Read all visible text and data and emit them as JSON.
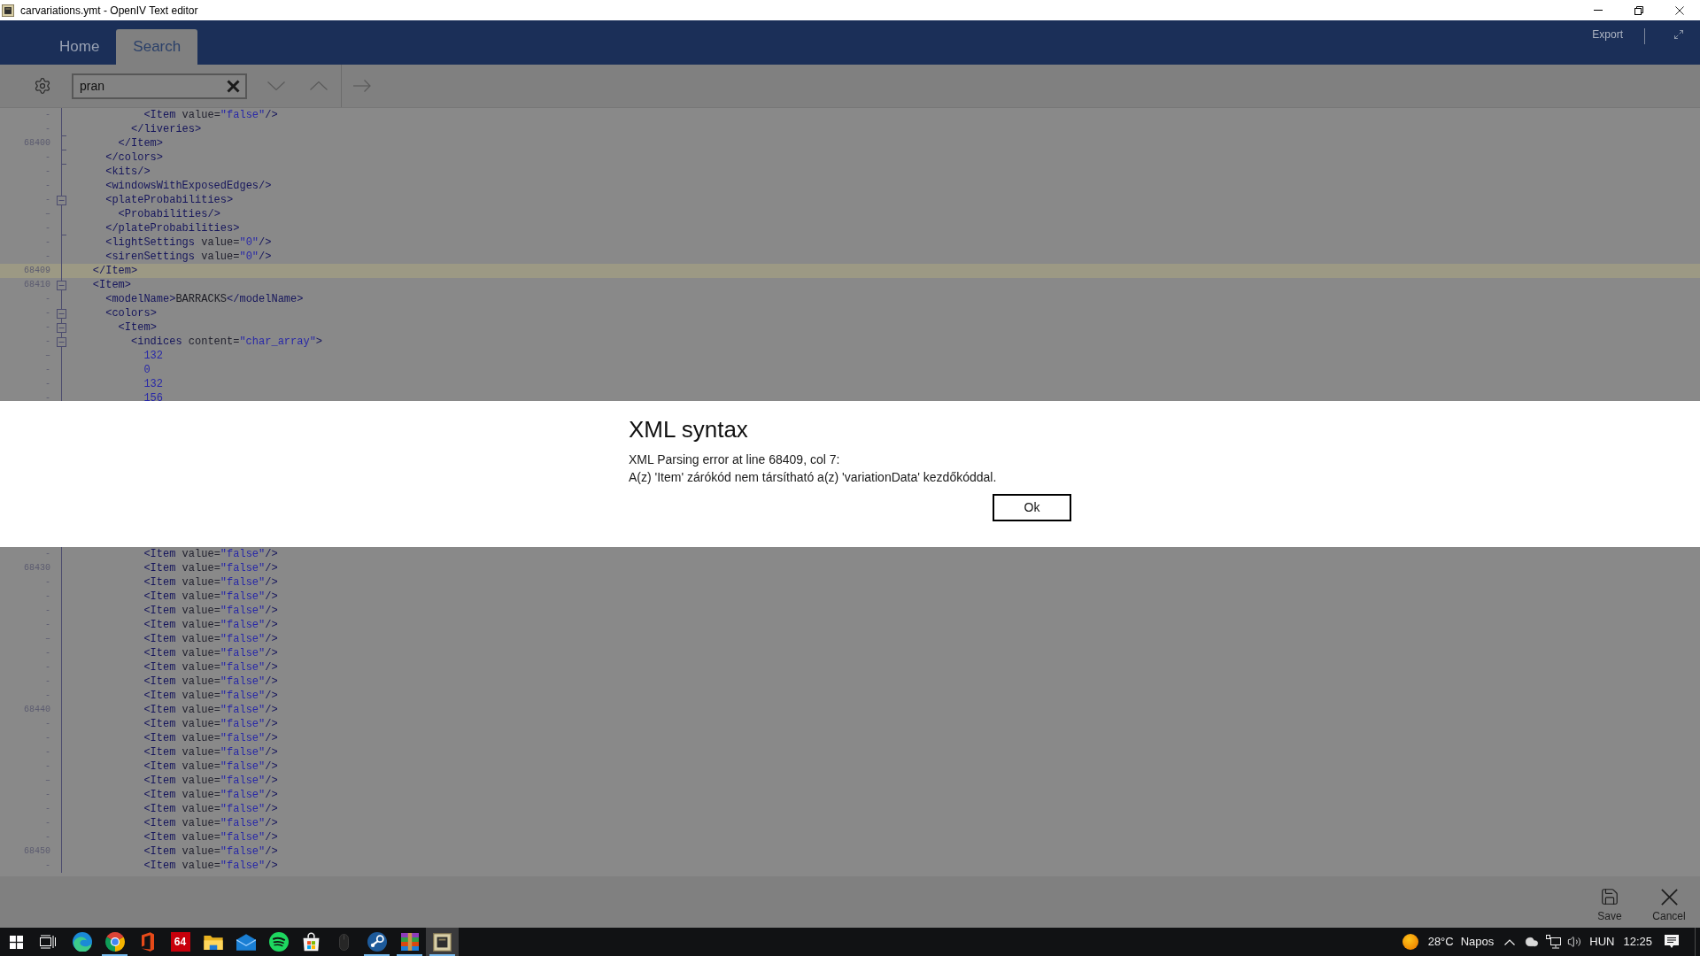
{
  "window": {
    "title": "carvariations.ymt - OpenIV Text editor"
  },
  "ribbon": {
    "tabs": [
      {
        "label": "Home",
        "selected": false
      },
      {
        "label": "Search",
        "selected": true
      }
    ],
    "action": "Export"
  },
  "search": {
    "value": "pran"
  },
  "editor": {
    "upper_lines": [
      {
        "kind": "plain",
        "number": "-",
        "code": "            <Item value=\"false\"/>",
        "current": false
      },
      {
        "kind": "fold_end",
        "number": "-",
        "code": "          </liveries>",
        "current": false
      },
      {
        "kind": "fold_end",
        "number": "68400",
        "code": "        </Item>",
        "current": false
      },
      {
        "kind": "fold_end",
        "number": "-",
        "code": "      </colors>",
        "current": false
      },
      {
        "kind": "plain",
        "number": "-",
        "code": "      <kits/>",
        "current": false
      },
      {
        "kind": "plain",
        "number": "-",
        "code": "      <windowsWithExposedEdges/>",
        "current": false
      },
      {
        "kind": "fold_start",
        "number": "-",
        "code": "      <plateProbabilities>",
        "current": false
      },
      {
        "kind": "plain",
        "number": "–",
        "code": "        <Probabilities/>",
        "current": false
      },
      {
        "kind": "fold_end",
        "number": "-",
        "code": "      </plateProbabilities>",
        "current": false
      },
      {
        "kind": "plain",
        "number": "-",
        "code": "      <lightSettings value=\"0\"/>",
        "current": false
      },
      {
        "kind": "plain",
        "number": "-",
        "code": "      <sirenSettings value=\"0\"/>",
        "current": false
      },
      {
        "kind": "plain",
        "number": "68409",
        "code": "    </Item>",
        "current": true
      },
      {
        "kind": "fold_start",
        "number": "68410",
        "code": "    <Item>",
        "current": false
      },
      {
        "kind": "plain",
        "number": "-",
        "code": "      <modelName>BARRACKS</modelName>",
        "current": false
      },
      {
        "kind": "fold_start",
        "number": "-",
        "code": "      <colors>",
        "current": false
      },
      {
        "kind": "fold_start",
        "number": "-",
        "code": "        <Item>",
        "current": false
      },
      {
        "kind": "fold_start",
        "number": "-",
        "code": "          <indices content=\"char_array\">",
        "current": false
      },
      {
        "kind": "plain",
        "number": "–",
        "code": "            132",
        "current": false
      },
      {
        "kind": "plain",
        "number": "-",
        "code": "            0",
        "current": false
      },
      {
        "kind": "plain",
        "number": "-",
        "code": "            132",
        "current": false
      },
      {
        "kind": "plain",
        "number": "-",
        "code": "            156",
        "current": false
      }
    ],
    "lower_lines": [
      {
        "number": "-",
        "code": "            <Item value=\"false\"/>",
        "current": false
      },
      {
        "number": "68430",
        "code": "            <Item value=\"false\"/>",
        "current": false
      },
      {
        "number": "-",
        "code": "            <Item value=\"false\"/>",
        "current": false
      },
      {
        "number": "-",
        "code": "            <Item value=\"false\"/>",
        "current": false
      },
      {
        "number": "-",
        "code": "            <Item value=\"false\"/>",
        "current": false
      },
      {
        "number": "-",
        "code": "            <Item value=\"false\"/>",
        "current": false
      },
      {
        "number": "–",
        "code": "            <Item value=\"false\"/>",
        "current": false
      },
      {
        "number": "-",
        "code": "            <Item value=\"false\"/>",
        "current": false
      },
      {
        "number": "-",
        "code": "            <Item value=\"false\"/>",
        "current": false
      },
      {
        "number": "-",
        "code": "            <Item value=\"false\"/>",
        "current": false
      },
      {
        "number": "-",
        "code": "            <Item value=\"false\"/>",
        "current": false
      },
      {
        "number": "68440",
        "code": "            <Item value=\"false\"/>",
        "current": false
      },
      {
        "number": "-",
        "code": "            <Item value=\"false\"/>",
        "current": false
      },
      {
        "number": "-",
        "code": "            <Item value=\"false\"/>",
        "current": false
      },
      {
        "number": "-",
        "code": "            <Item value=\"false\"/>",
        "current": false
      },
      {
        "number": "-",
        "code": "            <Item value=\"false\"/>",
        "current": false
      },
      {
        "number": "–",
        "code": "            <Item value=\"false\"/>",
        "current": false
      },
      {
        "number": "-",
        "code": "            <Item value=\"false\"/>",
        "current": false
      },
      {
        "number": "-",
        "code": "            <Item value=\"false\"/>",
        "current": false
      },
      {
        "number": "-",
        "code": "            <Item value=\"false\"/>",
        "current": false
      },
      {
        "number": "-",
        "code": "            <Item value=\"false\"/>",
        "current": false
      },
      {
        "number": "68450",
        "code": "            <Item value=\"false\"/>",
        "current": false
      },
      {
        "number": "-",
        "code": "            <Item value=\"false\"/>",
        "current": false
      }
    ]
  },
  "dialog": {
    "title": "XML syntax",
    "message_lines": [
      "XML Parsing error at line 68409, col 7:",
      "A(z) 'Item' zárókód nem társítható a(z) 'variationData' kezdőkóddal."
    ],
    "buttons": [
      "Ok"
    ]
  },
  "footer": {
    "buttons": [
      {
        "kind": "save",
        "label": "Save"
      },
      {
        "kind": "cancel",
        "label": "Cancel"
      }
    ]
  },
  "taskbar": {
    "apps": [
      {
        "kind": "swirl",
        "running": false,
        "selected": false
      },
      {
        "kind": "segments",
        "running": true,
        "selected": false
      },
      {
        "kind": "doorway",
        "running": false,
        "selected": false
      },
      {
        "kind": "tile",
        "text": "64",
        "running": false,
        "selected": false
      },
      {
        "kind": "folder",
        "running": false,
        "selected": false
      },
      {
        "kind": "envelope",
        "running": false,
        "selected": false
      },
      {
        "kind": "waves",
        "running": false,
        "selected": false
      },
      {
        "kind": "bag",
        "running": false,
        "selected": false
      },
      {
        "kind": "mouse",
        "running": false,
        "selected": false
      },
      {
        "kind": "piston",
        "running": true,
        "selected": false
      },
      {
        "kind": "books",
        "running": true,
        "selected": false
      },
      {
        "kind": "plaque",
        "running": true,
        "selected": true
      }
    ],
    "tray": {
      "temperature": "28°C",
      "condition": "Napos",
      "language": "HUN",
      "time": "12:25"
    }
  }
}
